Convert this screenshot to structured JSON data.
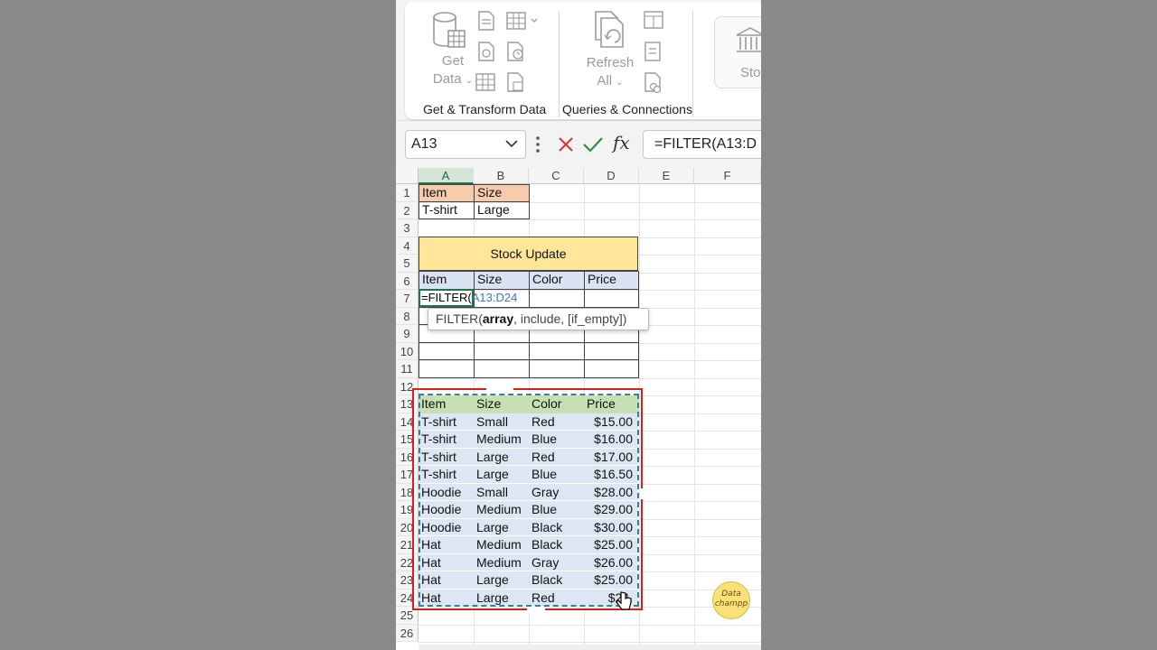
{
  "ribbon": {
    "get_data": {
      "line1": "Get",
      "line2": "Data"
    },
    "refresh_all": {
      "line1": "Refresh",
      "line2": "All"
    },
    "stocks": "Stoc",
    "groups": [
      "Get & Transform Data",
      "Queries & Connections"
    ]
  },
  "formula_bar": {
    "name_box": "A13",
    "formula": "=FILTER(A13:D"
  },
  "columns": [
    "A",
    "B",
    "C",
    "D",
    "E",
    "F"
  ],
  "rows": [
    "1",
    "2",
    "3",
    "4",
    "5",
    "6",
    "7",
    "8",
    "9",
    "10",
    "11",
    "12",
    "13",
    "14",
    "15",
    "16",
    "17",
    "18",
    "19",
    "20",
    "21",
    "22",
    "23",
    "24",
    "25",
    "26"
  ],
  "criteria": {
    "headers": [
      "Item",
      "Size"
    ],
    "values": [
      "T-shirt",
      "Large"
    ]
  },
  "stock_update": {
    "title": "Stock Update",
    "headers": [
      "Item",
      "Size",
      "Color",
      "Price"
    ]
  },
  "editing": {
    "prefix": "=FILTER(",
    "ref": "A13:D24"
  },
  "tooltip": {
    "fn": "FILTER(",
    "arg_bold": "array",
    "rest": ", include, [if_empty])"
  },
  "source_table": {
    "headers": [
      "Item",
      "Size",
      "Color",
      "Price"
    ],
    "rows": [
      [
        "T-shirt",
        "Small",
        "Red",
        "$15.00"
      ],
      [
        "T-shirt",
        "Medium",
        "Blue",
        "$16.00"
      ],
      [
        "T-shirt",
        "Large",
        "Red",
        "$17.00"
      ],
      [
        "T-shirt",
        "Large",
        "Blue",
        "$16.50"
      ],
      [
        "Hoodie",
        "Small",
        "Gray",
        "$28.00"
      ],
      [
        "Hoodie",
        "Medium",
        "Blue",
        "$29.00"
      ],
      [
        "Hoodie",
        "Large",
        "Black",
        "$30.00"
      ],
      [
        "Hat",
        "Medium",
        "Black",
        "$25.00"
      ],
      [
        "Hat",
        "Medium",
        "Gray",
        "$26.00"
      ],
      [
        "Hat",
        "Large",
        "Black",
        "$25.00"
      ],
      [
        "Hat",
        "Large",
        "Red",
        "$24."
      ]
    ]
  },
  "logo": {
    "line1": "Data",
    "line2": "champp"
  },
  "colors": {
    "excel_green": "#217346",
    "orange_header": "#f8cbad",
    "blue_header": "#dae3f3",
    "green_header": "#c6e0b4",
    "title_yellow": "#ffe699",
    "red_outline": "#d62020"
  },
  "icons": [
    "database-icon",
    "sheet-icon",
    "table-icon",
    "refresh-icon",
    "bank-icon",
    "close-icon",
    "check-icon",
    "chevron-down-icon",
    "more-dots-icon",
    "cursor-icon"
  ]
}
